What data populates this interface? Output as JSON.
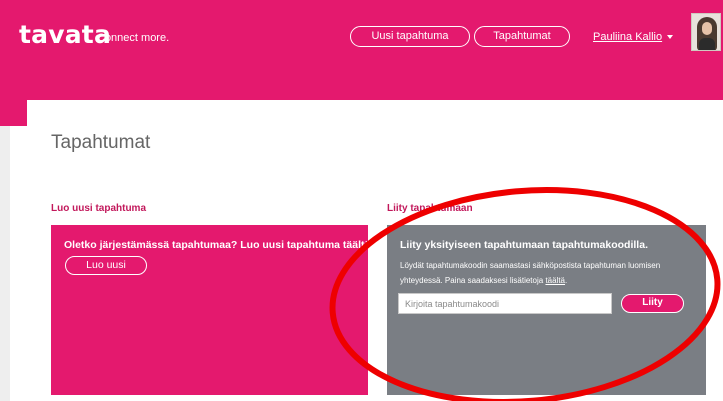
{
  "header": {
    "logo": "tavata",
    "tagline": "Connect more.",
    "nav": {
      "new_event": "Uusi tapahtuma",
      "events": "Tapahtumat"
    },
    "user": {
      "name": "Pauliina Kallio"
    }
  },
  "main": {
    "title": "Tapahtumat",
    "create_section": {
      "label": "Luo uusi tapahtuma",
      "card_title": "Oletko järjestämässä tapahtumaa? Luo uusi tapahtuma täältä.",
      "button": "Luo uusi"
    },
    "join_section": {
      "label": "Liity tapahtumaan",
      "card_title": "Liity yksityiseen tapahtumaan tapahtumakoodilla.",
      "description": "Löydät tapahtumakoodin saamastasi sähköpostista tapahtuman luomisen yhteydessä. Paina saadaksesi lisätietoja",
      "link": "täältä",
      "input_placeholder": "Kirjoita tapahtumakoodi",
      "input_value": "",
      "button": "Liity"
    }
  },
  "colors": {
    "brand_pink": "#e4196e",
    "card_grey": "#7a7e84",
    "annotation_red": "#ee0000"
  }
}
